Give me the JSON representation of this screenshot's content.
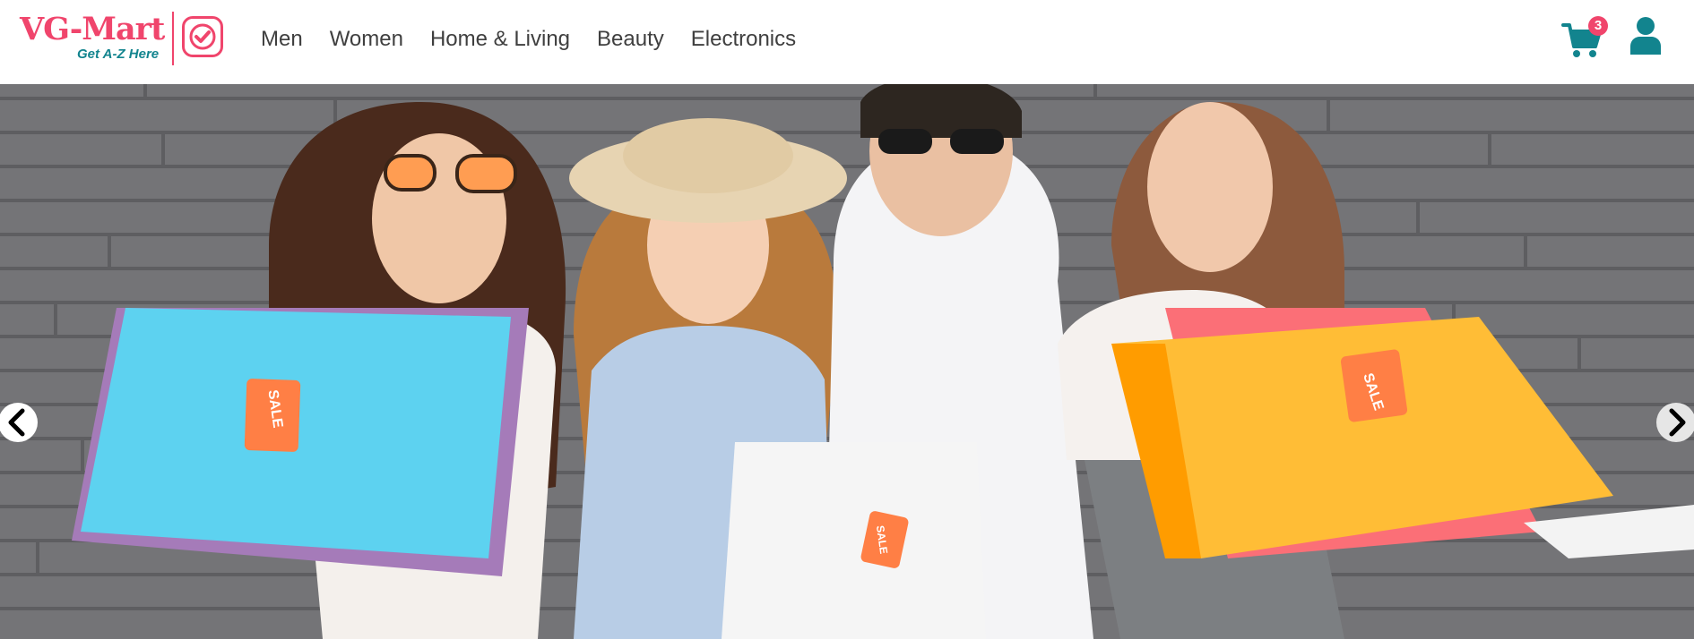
{
  "brand": {
    "name": "VG-Mart",
    "tagline": "Get A-Z Here",
    "primary_color": "#f0456c",
    "secondary_color": "#12848e"
  },
  "nav": {
    "items": [
      {
        "label": "Men"
      },
      {
        "label": "Women"
      },
      {
        "label": "Home & Living"
      },
      {
        "label": "Beauty"
      },
      {
        "label": "Electronics"
      }
    ]
  },
  "cart": {
    "count": "3",
    "icon": "cart-icon"
  },
  "user": {
    "icon": "user-icon"
  },
  "carousel": {
    "prev_icon": "chevron-left-icon",
    "next_icon": "chevron-right-icon",
    "slide": {
      "tags": [
        "SALE",
        "SALE",
        "SALE"
      ]
    }
  }
}
